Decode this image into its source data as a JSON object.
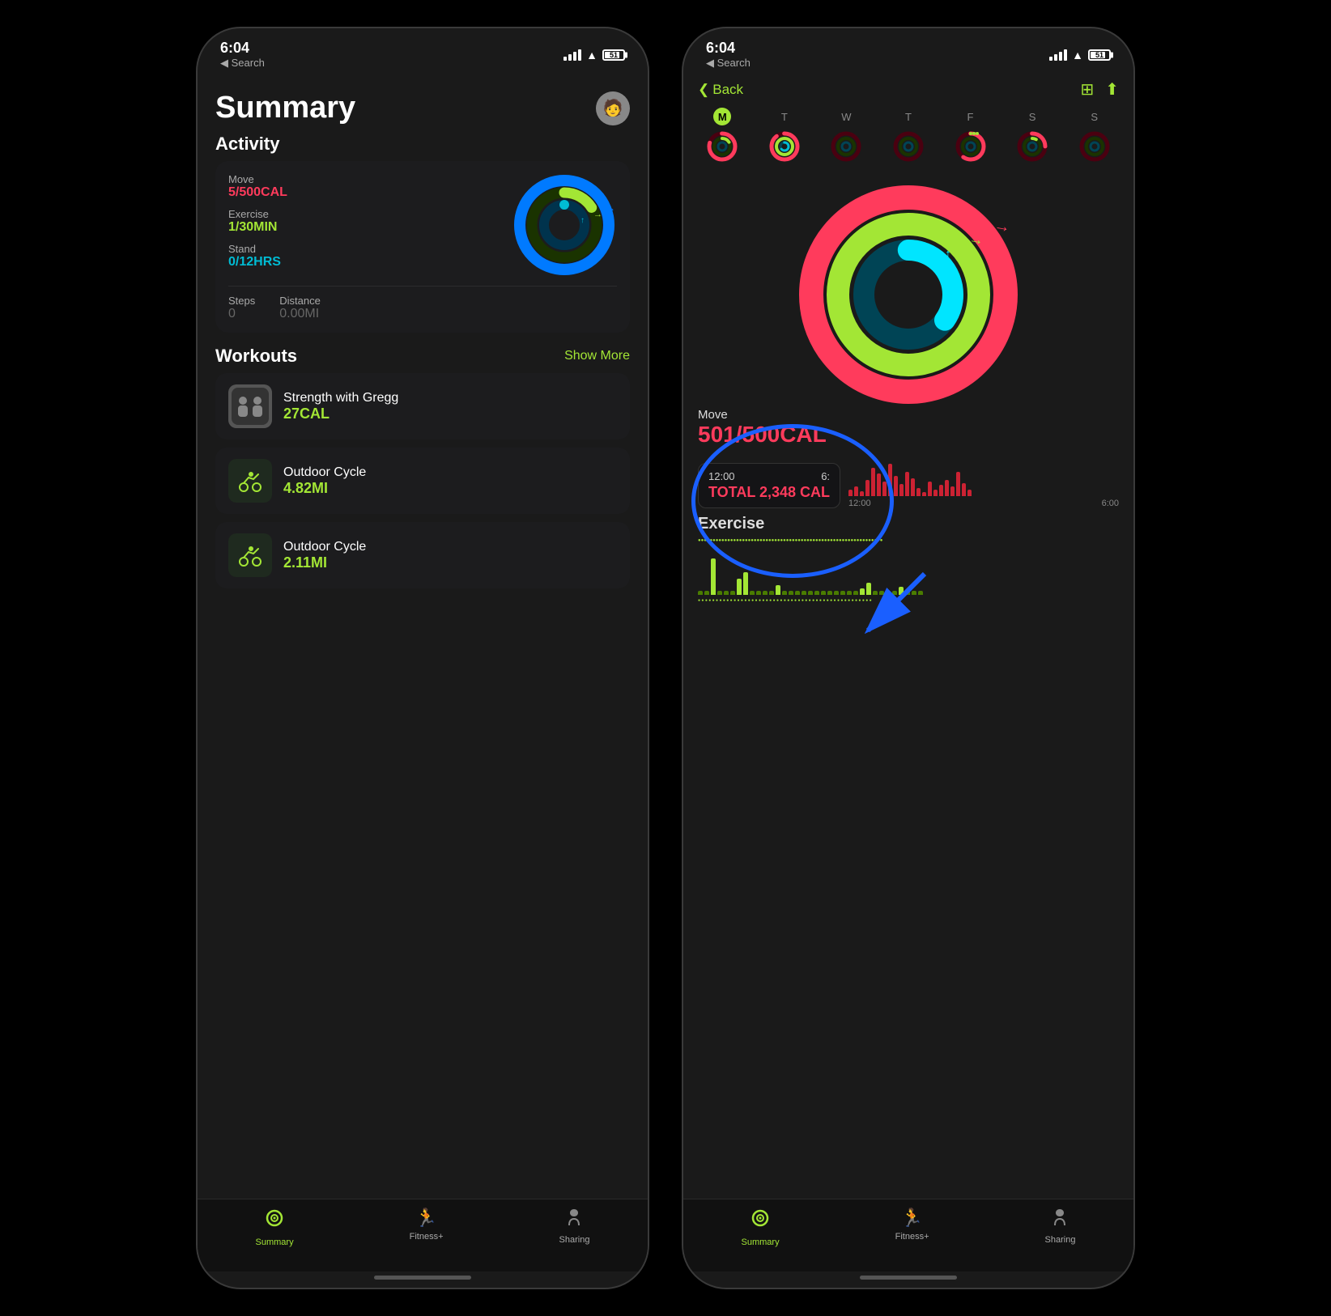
{
  "left_phone": {
    "status": {
      "time": "6:04",
      "back_label": "◀ Search",
      "battery": "51"
    },
    "page_title": "Summary",
    "avatar_emoji": "🧑",
    "activity": {
      "section_label": "Activity",
      "move_label": "Move",
      "move_value": "5/500CAL",
      "exercise_label": "Exercise",
      "exercise_value": "1/30MIN",
      "stand_label": "Stand",
      "stand_value": "0/12HRS",
      "steps_label": "Steps",
      "steps_value": "0",
      "distance_label": "Distance",
      "distance_value": "0.00MI"
    },
    "workouts": {
      "section_label": "Workouts",
      "show_more_label": "Show More",
      "items": [
        {
          "name": "Strength with Gregg",
          "value": "27CAL",
          "icon": "🏋️",
          "type": "image"
        },
        {
          "name": "Outdoor Cycle",
          "value": "4.82MI",
          "icon": "🚴",
          "type": "bike"
        },
        {
          "name": "Outdoor Cycle",
          "value": "2.11MI",
          "icon": "🚴",
          "type": "bike"
        }
      ]
    },
    "tabs": [
      {
        "label": "Summary",
        "icon": "⊙",
        "active": true
      },
      {
        "label": "Fitness+",
        "icon": "🏃"
      },
      {
        "label": "Sharing",
        "icon": "S"
      }
    ]
  },
  "right_phone": {
    "status": {
      "time": "6:04",
      "back_label": "◀ Search",
      "battery": "51"
    },
    "nav": {
      "back_label": "Back",
      "calendar_icon": "📅",
      "share_icon": "⬆"
    },
    "week": {
      "days": [
        "M",
        "T",
        "W",
        "T",
        "F",
        "S",
        "S"
      ],
      "active_index": 0
    },
    "move": {
      "label": "Move",
      "value": "501/500CAL"
    },
    "callout": {
      "time_start": "12:00",
      "time_end": "6:",
      "total_label": "TOTAL 2,348 CAL"
    },
    "exercise_label": "Exercise",
    "tabs": [
      {
        "label": "Summary",
        "icon": "⊙",
        "active": true
      },
      {
        "label": "Fitness+",
        "icon": "🏃"
      },
      {
        "label": "Sharing",
        "icon": "S"
      }
    ]
  }
}
